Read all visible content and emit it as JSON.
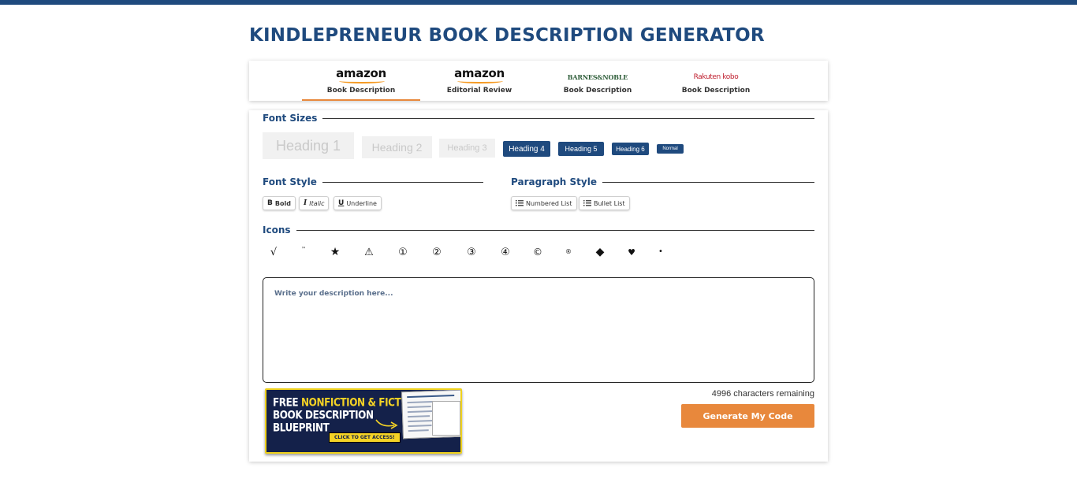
{
  "header": {
    "title": "KINDLEPRENEUR BOOK DESCRIPTION GENERATOR"
  },
  "tabs": [
    {
      "logo": "amazon",
      "label": "Book Description",
      "active": true
    },
    {
      "logo": "amazon",
      "label": "Editorial Review",
      "active": false
    },
    {
      "logo": "BARNES&NOBLE",
      "label": "Book Description",
      "active": false
    },
    {
      "logo": "Rakuten kobo",
      "label": "Book Description",
      "active": false
    }
  ],
  "font_sizes": {
    "title": "Font Sizes",
    "buttons": [
      "Heading 1",
      "Heading 2",
      "Heading 3",
      "Heading 4",
      "Heading 5",
      "Heading 6",
      "Normal"
    ]
  },
  "font_style": {
    "title": "Font Style",
    "bold": {
      "glyph": "B",
      "label": "Bold"
    },
    "italic": {
      "glyph": "I",
      "label": "Italic"
    },
    "underline": {
      "glyph": "U",
      "label": "Underline"
    }
  },
  "paragraph_style": {
    "title": "Paragraph Style",
    "numbered": {
      "icon": "numbered-list-icon",
      "label": "Numbered List"
    },
    "bullet": {
      "icon": "bullet-list-icon",
      "label": "Bullet List"
    }
  },
  "icons": {
    "title": "Icons",
    "items": [
      "√",
      "™",
      "★",
      "⚠",
      "①",
      "②",
      "③",
      "④",
      "©",
      "®",
      "◆",
      "♥",
      "•"
    ]
  },
  "editor": {
    "placeholder": "Write your description here..."
  },
  "banner": {
    "line1_a": "FREE ",
    "line1_b": "NONFICTION & FICTION",
    "line2": "BOOK DESCRIPTION",
    "line3": "BLUEPRINT",
    "cta": "CLICK TO GET ACCESS!"
  },
  "footer": {
    "chars_remaining": "4996 characters remaining",
    "generate_label": "Generate My Code"
  },
  "colors": {
    "brand": "#1f4a7e",
    "accent": "#e8883c",
    "banner_bg": "#14214a",
    "banner_yellow": "#f4d225"
  }
}
